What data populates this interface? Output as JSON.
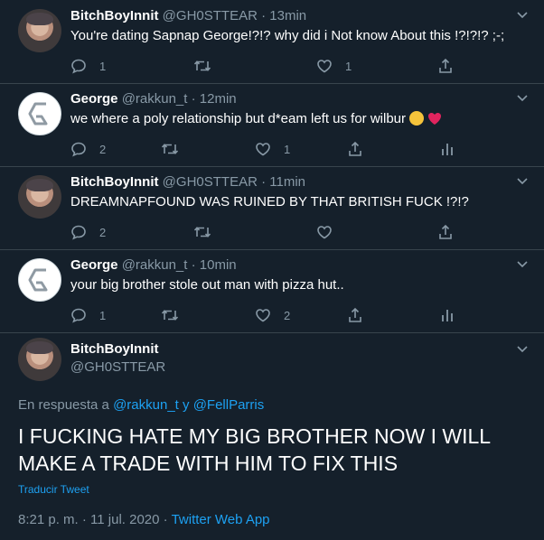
{
  "tweets": [
    {
      "name": "BitchBoyInnit",
      "handle": "@GH0STTEAR",
      "time": "13min",
      "text": "You're dating Sapnap George!?!? why did i Not know About this !?!?!? ;-;",
      "reply_count": "1",
      "retweet_count": "",
      "like_count": "1"
    },
    {
      "name": "George",
      "handle": "@rakkun_t",
      "time": "12min",
      "text": "we where a poly relationship but d*eam left us for wilbur",
      "reply_count": "2",
      "retweet_count": "",
      "like_count": "1"
    },
    {
      "name": "BitchBoyInnit",
      "handle": "@GH0STTEAR",
      "time": "11min",
      "text": "DREAMNAPFOUND WAS RUINED BY THAT BRITISH FUCK !?!?",
      "reply_count": "2",
      "retweet_count": "",
      "like_count": ""
    },
    {
      "name": "George",
      "handle": "@rakkun_t",
      "time": "10min",
      "text": "your big brother stole out man with pizza hut..",
      "reply_count": "1",
      "retweet_count": "",
      "like_count": "2"
    }
  ],
  "main": {
    "name": "BitchBoyInnit",
    "handle": "@GH0STTEAR",
    "reply_prefix": "En respuesta a",
    "reply_user1": "@rakkun_t",
    "reply_joiner": "y",
    "reply_user2": "@FellParris",
    "text": "I FUCKING HATE MY BIG BROTHER NOW I WILL MAKE A TRADE WITH HIM TO FIX THIS",
    "translate": "Traducir Tweet",
    "timestamp": "8:21 p. m. · 11 jul. 2020 ·",
    "source": "Twitter Web App"
  },
  "icons": {
    "reply": "reply-icon",
    "retweet": "retweet-icon",
    "like": "heart-icon",
    "share": "share-icon",
    "analytics": "analytics-icon",
    "chevron": "chevron-down-icon"
  },
  "colors": {
    "background": "#15202b",
    "secondary_text": "#8899a6",
    "link": "#1da1f2",
    "divider": "#38444d"
  }
}
